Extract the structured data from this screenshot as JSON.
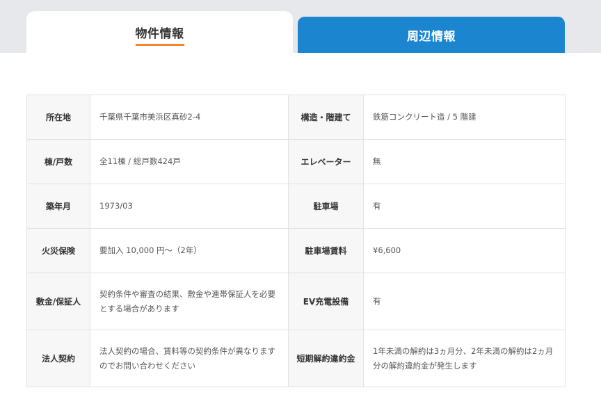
{
  "tabs": {
    "active_label": "物件情報",
    "inactive_label": "周辺情報"
  },
  "colors": {
    "tab_active_underline": "#f0872f",
    "tab_inactive_bg": "#1b86cf",
    "header_band": "#e6e8eb",
    "label_cell_bg": "#f7f7f7"
  },
  "rows": [
    {
      "label1": "所在地",
      "value1": "千葉県千葉市美浜区真砂2-4",
      "label2": "構造・階建て",
      "value2": "鉄筋コンクリート造 / 5 階建"
    },
    {
      "label1": "棟/戸数",
      "value1": "全11棟 / 総戸数424戸",
      "label2": "エレベーター",
      "value2": "無"
    },
    {
      "label1": "築年月",
      "value1": "1973/03",
      "label2": "駐車場",
      "value2": "有"
    },
    {
      "label1": "火災保険",
      "value1": "要加入 10,000 円～（2年）",
      "label2": "駐車場賃料",
      "value2": "¥6,600"
    },
    {
      "label1": "敷金/保証人",
      "value1": "契約条件や審査の結果、敷金や連帯保証人を必要とする場合があります",
      "label2": "EV充電設備",
      "value2": "有"
    },
    {
      "label1": "法人契約",
      "value1": "法人契約の場合、賃料等の契約条件が異なりますのでお問い合わせください",
      "label2": "短期解約違約金",
      "value2": "1年未満の解約は3ヵ月分、2年未満の解約は2ヵ月分の解約違約金が発生します"
    }
  ]
}
